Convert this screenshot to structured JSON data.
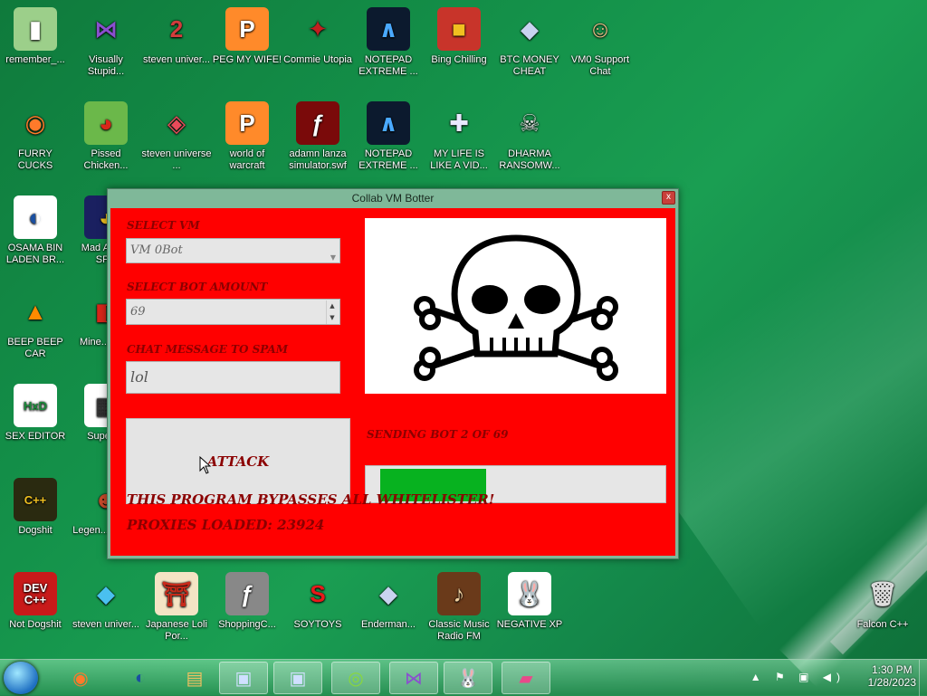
{
  "desktop": {
    "icons": [
      {
        "label": "remember_...",
        "icon": "folder-icon",
        "glyph": "▮",
        "bg": "#9ccf8a",
        "fg": "#ffffff"
      },
      {
        "label": "Visually Stupid...",
        "icon": "visual-studio-icon",
        "glyph": "⋈",
        "bg": "transparent",
        "fg": "#8a4fcf"
      },
      {
        "label": "steven univer...",
        "icon": "steven-universe-icon",
        "glyph": "2",
        "bg": "transparent",
        "fg": "#d23c3c"
      },
      {
        "label": "PEG MY WIFE!",
        "icon": "peg-icon",
        "glyph": "P",
        "bg": "#ff8a2a",
        "fg": "#ffffff"
      },
      {
        "label": "Commie Utopia",
        "icon": "commie-utopia-icon",
        "glyph": "✦",
        "bg": "transparent",
        "fg": "#c21f1f"
      },
      {
        "label": "NOTEPAD EXTREME ...",
        "icon": "notepad-extreme-icon",
        "glyph": "∧",
        "bg": "#0c1a2e",
        "fg": "#4aa9ff"
      },
      {
        "label": "Bing Chilling",
        "icon": "bing-chilling-icon",
        "glyph": "■",
        "bg": "#c8342a",
        "fg": "#f0c020"
      },
      {
        "label": "BTC MONEY CHEAT",
        "icon": "btc-money-cheat-icon",
        "glyph": "◆",
        "bg": "transparent",
        "fg": "#c8d3f0"
      },
      {
        "label": "VM0 Support Chat",
        "icon": "doctor-icon",
        "glyph": "☺",
        "bg": "transparent",
        "fg": "#f2c08a"
      },
      {
        "label": "FURRY CUCKS",
        "icon": "firefox-icon",
        "glyph": "◉",
        "bg": "transparent",
        "fg": "#ff7a2a"
      },
      {
        "label": "Pissed Chicken...",
        "icon": "angry-birds-icon",
        "glyph": "◕",
        "bg": "#6bb84a",
        "fg": "#d8261a"
      },
      {
        "label": "steven universe ...",
        "icon": "gem-icon",
        "glyph": "◈",
        "bg": "transparent",
        "fg": "#e84a5a"
      },
      {
        "label": "world of warcraft",
        "icon": "world-of-warcraft-icon",
        "glyph": "P",
        "bg": "#ff8a2a",
        "fg": "#ffffff"
      },
      {
        "label": "adamn lanza simulator.swf",
        "icon": "flash-file-icon",
        "glyph": "ƒ",
        "bg": "#7a0a0a",
        "fg": "#ffffff"
      },
      {
        "label": "NOTEPAD EXTREME ...",
        "icon": "notepad-extreme-icon",
        "glyph": "∧",
        "bg": "#0c1a2e",
        "fg": "#4aa9ff"
      },
      {
        "label": "MY LIFE IS LIKE A VID...",
        "icon": "gamepad-icon",
        "glyph": "✚",
        "bg": "transparent",
        "fg": "#e8e8ff"
      },
      {
        "label": "DHARMA RANSOMW...",
        "icon": "skull-headphones-icon",
        "glyph": "☠",
        "bg": "transparent",
        "fg": "#dddddd"
      },
      {
        "label": "OSAMA BIN LADEN BR...",
        "icon": "obama-logo-icon",
        "glyph": "◐",
        "bg": "#ffffff",
        "fg": "#1a4fa0"
      },
      {
        "label": "Mad A... IN SP...",
        "icon": "angry-birds-space-icon",
        "glyph": "◕",
        "bg": "#1a2060",
        "fg": "#f0c020"
      },
      {
        "label": "BEEP BEEP CAR",
        "icon": "vlc-icon",
        "glyph": "▲",
        "bg": "transparent",
        "fg": "#ff8a00"
      },
      {
        "label": "Mine... Bir...",
        "icon": "minecraft-icon",
        "glyph": "◧",
        "bg": "transparent",
        "fg": "#d8261a"
      },
      {
        "label": "SEX EDITOR",
        "icon": "hxd-icon",
        "glyph": "HxD",
        "bg": "#ffffff",
        "fg": "#1a8a3a"
      },
      {
        "label": "Super ...",
        "icon": "super-icon",
        "glyph": "▦",
        "bg": "#ffffff",
        "fg": "#333333"
      },
      {
        "label": "Dogshit",
        "icon": "codeblocks-icon",
        "glyph": "C++",
        "bg": "#2a2a10",
        "fg": "#f0c020"
      },
      {
        "label": "Legen... CRY...",
        "icon": "legend-icon",
        "glyph": "☻",
        "bg": "transparent",
        "fg": "#c84a2a"
      },
      {
        "label": "Not Dogshit",
        "icon": "dev-cpp-icon",
        "glyph": "DEV C++",
        "bg": "#c81a1a",
        "fg": "#ffffff"
      },
      {
        "label": "steven univer...",
        "icon": "diamond-icon",
        "glyph": "◆",
        "bg": "transparent",
        "fg": "#4ac0f0"
      },
      {
        "label": "Japanese Loli Por...",
        "icon": "torii-icon",
        "glyph": "⛩",
        "bg": "#f4e4c4",
        "fg": "#c82a1a"
      },
      {
        "label": "ShoppingC...",
        "icon": "flash-icon",
        "glyph": "ƒ",
        "bg": "#888888",
        "fg": "#ffffff"
      },
      {
        "label": "SOYTOYS",
        "icon": "soytoys-icon",
        "glyph": "S",
        "bg": "transparent",
        "fg": "#e81a1a"
      },
      {
        "label": "Enderman...",
        "icon": "enderman-icon",
        "glyph": "◆",
        "bg": "transparent",
        "fg": "#c8d3f0"
      },
      {
        "label": "Classic Music Radio FM",
        "icon": "classic-music-icon",
        "glyph": "♪",
        "bg": "#6a3a1a",
        "fg": "#f0d0a0"
      },
      {
        "label": "NEGATIVE XP",
        "icon": "bunny-icon",
        "glyph": "🐰",
        "bg": "#ffffff",
        "fg": "#333333"
      },
      {
        "label": "Falcon C++",
        "icon": "recycle-bin-icon",
        "glyph": "🗑",
        "bg": "transparent",
        "fg": "#dddddd"
      }
    ]
  },
  "window": {
    "title": "Collab VM Botter",
    "close": "x",
    "select_vm_label": "SELECT VM",
    "select_vm_value": "VM 0Bot",
    "bot_amount_label": "SELECT BOT AMOUNT",
    "bot_amount_value": "69",
    "chat_label": "CHAT MESSAGE TO SPAM",
    "chat_value": "lol",
    "attack_button": "ATTACK",
    "sending_status": "SENDING BOT 2 OF 69",
    "progress_fraction": 0.39,
    "bypass_text": "THIS PROGRAM BYPASSES ALL WHITELISTER!",
    "proxies_text": "PROXIES LOADED: 23924"
  },
  "taskbar": {
    "time": "1:30 PM",
    "date": "1/28/2023",
    "tray_icons": "▲ ⚑ ▣ ◀)",
    "buttons": [
      {
        "name": "firefox-icon",
        "glyph": "◉",
        "color": "#ff7a2a"
      },
      {
        "name": "obama-icon",
        "glyph": "◐",
        "color": "#1a4fa0"
      },
      {
        "name": "explorer-icon",
        "glyph": "▤",
        "color": "#f0c060"
      },
      {
        "name": "computer-icon",
        "glyph": "▣",
        "color": "#d0e0ff"
      },
      {
        "name": "computer-icon",
        "glyph": "▣",
        "color": "#d0e0ff"
      },
      {
        "name": "lime-icon",
        "glyph": "◎",
        "color": "#8ad83a"
      },
      {
        "name": "visual-studio-icon",
        "glyph": "⋈",
        "color": "#8a4fcf"
      },
      {
        "name": "bunny-icon",
        "glyph": "🐰",
        "color": "#ffffff"
      },
      {
        "name": "botter-app-icon",
        "glyph": "▰",
        "color": "#e84a8a"
      }
    ]
  }
}
